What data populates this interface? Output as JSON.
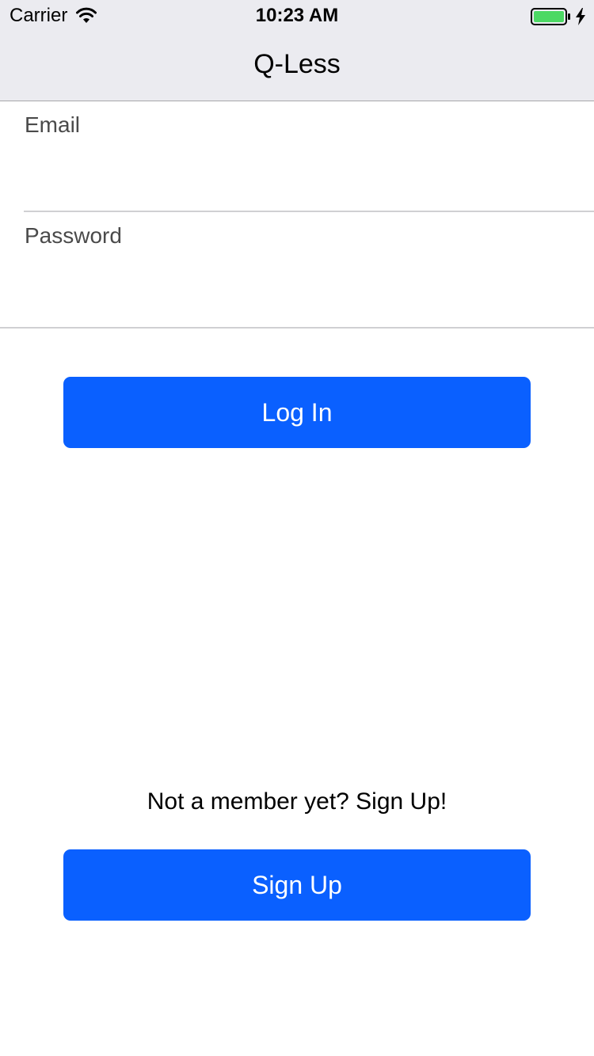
{
  "status_bar": {
    "carrier": "Carrier",
    "time": "10:23 AM",
    "battery_color": "#4cd964",
    "wifi_icon": "wifi-icon",
    "battery_icon": "battery-icon",
    "charging_icon": "bolt-icon"
  },
  "nav": {
    "title": "Q-Less"
  },
  "form": {
    "email": {
      "label": "Email",
      "value": "",
      "placeholder": ""
    },
    "password": {
      "label": "Password",
      "value": "",
      "placeholder": ""
    },
    "login_label": "Log In"
  },
  "signup": {
    "prompt": "Not a member yet? Sign Up!",
    "button_label": "Sign Up"
  },
  "colors": {
    "accent": "#0a60ff",
    "nav_background": "#ebebf0",
    "label_text": "#4a4a4a",
    "divider": "#d0d0d3"
  }
}
